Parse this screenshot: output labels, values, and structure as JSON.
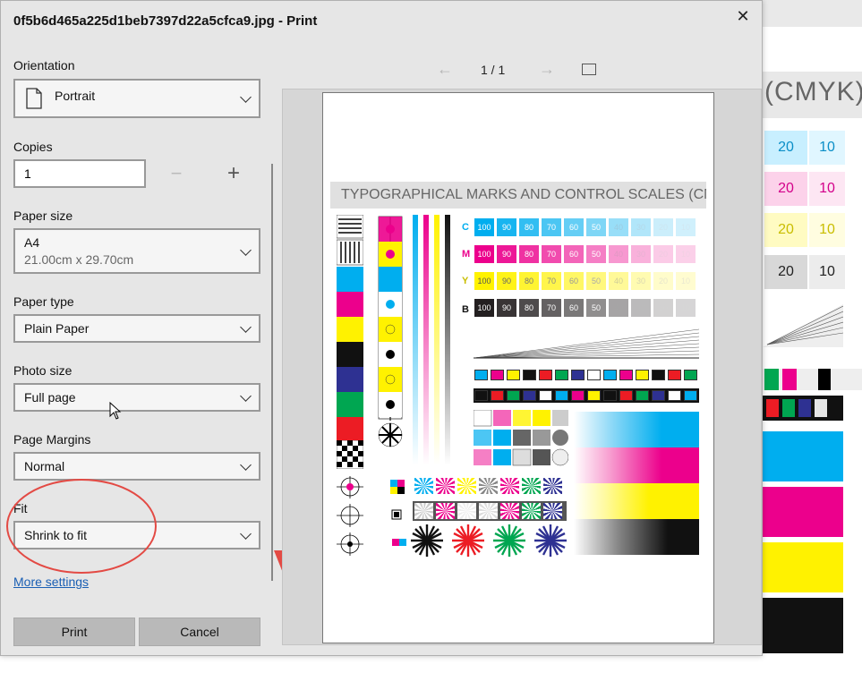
{
  "window": {
    "title": "0f5b6d465a225d1beb7397d22a5cfca9.jpg - Print",
    "close_glyph": "✕"
  },
  "orientation": {
    "label": "Orientation",
    "value": "Portrait"
  },
  "copies": {
    "label": "Copies",
    "value": "1",
    "minus": "−",
    "plus": "+"
  },
  "paper_size": {
    "label": "Paper size",
    "value": "A4",
    "detail": "21.00cm x 29.70cm"
  },
  "paper_type": {
    "label": "Paper type",
    "value": "Plain Paper"
  },
  "photo_size": {
    "label": "Photo size",
    "value": "Full page"
  },
  "page_margins": {
    "label": "Page Margins",
    "value": "Normal"
  },
  "fit": {
    "label": "Fit",
    "value": "Shrink to fit"
  },
  "more_settings": "More settings",
  "buttons": {
    "print": "Print",
    "cancel": "Cancel"
  },
  "preview": {
    "prev_glyph": "←",
    "next_glyph": "→",
    "page_indicator": "1 / 1",
    "sheet_title": "TYPOGRAPHICAL MARKS AND CONTROL SCALES (CMYK)",
    "row_letters": [
      "C",
      "M",
      "Y",
      "B"
    ],
    "scale_values": [
      "100",
      "90",
      "80",
      "70",
      "60",
      "50",
      "40",
      "30",
      "20",
      "10"
    ]
  },
  "background_app": {
    "heading": "(CMYK)",
    "values": [
      "20",
      "10",
      "20",
      "10",
      "20",
      "10",
      "20",
      "10"
    ]
  },
  "colors": {
    "cyan": "#00aeef",
    "magenta": "#ec008c",
    "yellow": "#fff200",
    "black": "#231f20",
    "annotation": "#e34a44"
  }
}
